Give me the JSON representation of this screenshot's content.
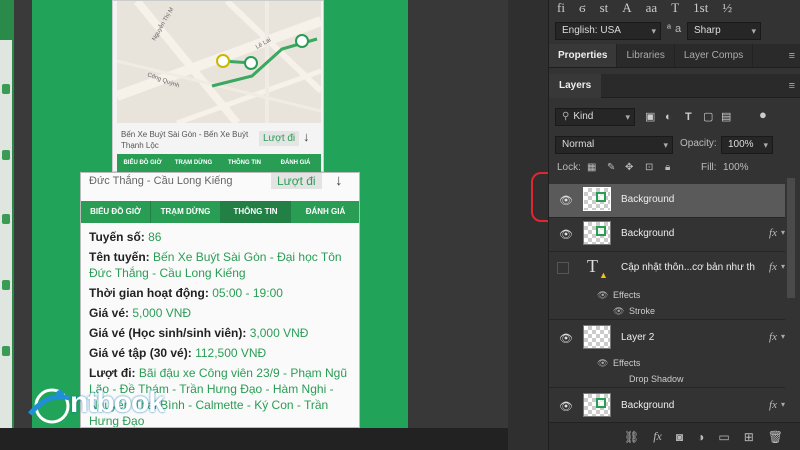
{
  "canvas": {
    "top_card": {
      "route_text": "Bến Xe Buýt Sài Gòn - Bến Xe Buýt Thạnh Lộc",
      "button": "Lượt đi",
      "arrow": "↓",
      "tabs": [
        "BIỂU ĐỒ GIỜ",
        "TRẠM DỪNG",
        "THÔNG TIN",
        "ĐÁNH GIÁ"
      ],
      "map_labels": [
        "Nguyễn Thị M",
        "Lê Lai",
        "Công Quỳnh"
      ]
    },
    "main_card": {
      "header": "Đức Thắng - Cầu Long Kiếng",
      "button": "Lượt đi",
      "arrow": "↓",
      "tabs": [
        "BIỂU ĐỒ GIỜ",
        "TRẠM DỪNG",
        "THÔNG TIN",
        "ĐÁNH GIÁ"
      ],
      "active_tab": "THÔNG TIN",
      "rows": [
        {
          "label": "Tuyến số:",
          "value": "86"
        },
        {
          "label": "Tên tuyến:",
          "value": "Bến Xe Buýt Sài Gòn - Đại học Tôn Đức Thắng - Cầu Long Kiếng"
        },
        {
          "label": "Thời gian hoạt động:",
          "value": "05:00 - 19:00"
        },
        {
          "label": "Giá vé:",
          "value": "5,000 VNĐ"
        },
        {
          "label": "Giá vé (Học sinh/sinh viên):",
          "value": "3,000 VNĐ"
        },
        {
          "label": "Giá vé tập (30 vé):",
          "value": "112,500 VNĐ"
        },
        {
          "label": "Lượt đi:",
          "value": "Bãi đậu xe Công viên 23/9 - Phạm Ngũ Lão - Đề Thám - Trần Hưng Đạo - Hàm Nghi - Nguyễn Thái Bình - Calmette - Ký Con - Trần Hưng Đạo"
        }
      ]
    },
    "logo": "ntbook"
  },
  "panel": {
    "glyphs": [
      "fi",
      "ϭ",
      "st",
      "A",
      "aa",
      "T",
      "1st",
      "½"
    ],
    "language": "English: USA",
    "aa_label": "a",
    "antialias": "Sharp",
    "tabs": [
      "Properties",
      "Libraries",
      "Layer Comps"
    ],
    "layers_tab": "Layers",
    "filter_kind": "Kind",
    "blend_mode": "Normal",
    "opacity_label": "Opacity:",
    "opacity_value": "100%",
    "lock_label": "Lock:",
    "fill_label": "Fill:",
    "fill_value": "100%",
    "layers": [
      {
        "name": "Background",
        "selected": true,
        "fx": false
      },
      {
        "name": "Background",
        "selected": false,
        "fx": true
      },
      {
        "name": "Cập nhật thôn...cơ bản như th",
        "selected": false,
        "fx": true,
        "type": "text"
      },
      {
        "name": "Layer 2",
        "selected": false,
        "fx": true
      },
      {
        "name": "Background",
        "selected": false,
        "fx": true
      }
    ],
    "effects_label": "Effects",
    "stroke_label": "Stroke",
    "drop_shadow_label": "Drop Shadow",
    "fx_symbol": "fx"
  }
}
